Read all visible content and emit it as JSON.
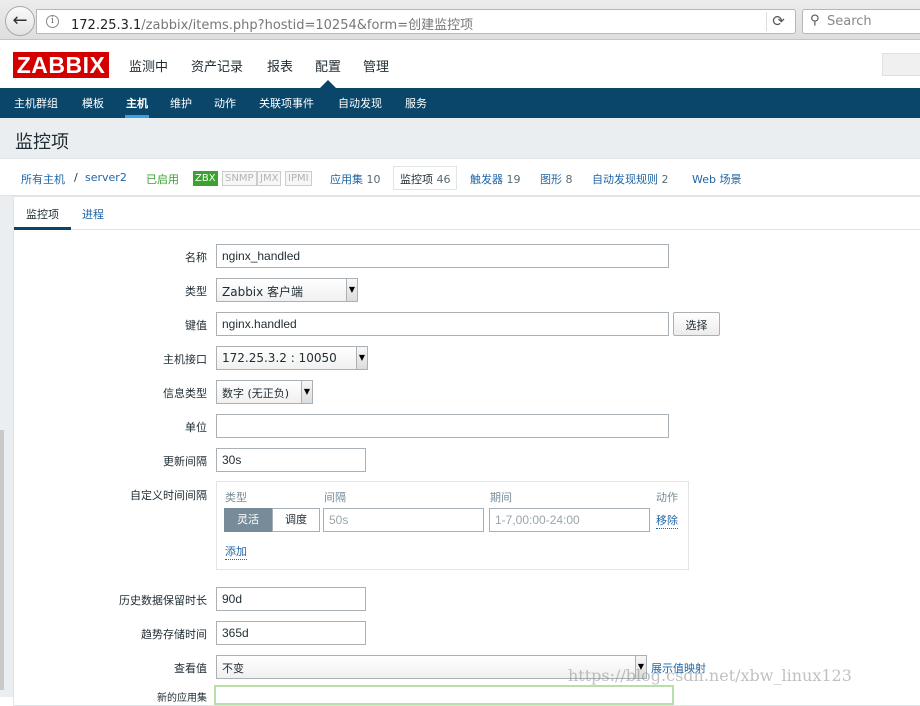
{
  "browser": {
    "url_host": "172.25.3.1",
    "url_rest": "/zabbix/items.php?hostid=10254&form=创建监控项",
    "search_placeholder": "Search"
  },
  "header": {
    "logo": "ZABBIX",
    "menu": [
      "监测中",
      "资产记录",
      "报表",
      "配置",
      "管理"
    ],
    "active_menu": "配置"
  },
  "submenu": {
    "items": [
      "主机群组",
      "模板",
      "主机",
      "维护",
      "动作",
      "关联项事件",
      "自动发现",
      "服务"
    ],
    "active": "主机"
  },
  "page_title": "监控项",
  "breadcrumb": {
    "all_hosts": "所有主机",
    "separator": "/",
    "host": "server2",
    "status": "已启用",
    "avail": [
      "ZBX",
      "SNMP",
      "JMX",
      "IPMI"
    ],
    "applications": {
      "label": "应用集",
      "count": "10"
    },
    "items": {
      "label": "监控项",
      "count": "46"
    },
    "triggers": {
      "label": "触发器",
      "count": "19"
    },
    "graphs": {
      "label": "图形",
      "count": "8"
    },
    "discovery": {
      "label": "自动发现规则",
      "count": "2"
    },
    "web": "Web 场景"
  },
  "tabs": [
    "监控项",
    "进程"
  ],
  "form": {
    "name": {
      "label": "名称",
      "value": "nginx_handled"
    },
    "type": {
      "label": "类型",
      "value": "Zabbix 客户端"
    },
    "key": {
      "label": "键值",
      "value": "nginx.handled",
      "button": "选择"
    },
    "interface": {
      "label": "主机接口",
      "value": "172.25.3.2 : 10050"
    },
    "info_type": {
      "label": "信息类型",
      "value": "数字 (无正负)"
    },
    "units": {
      "label": "单位",
      "value": ""
    },
    "update_interval": {
      "label": "更新间隔",
      "value": "30s"
    },
    "custom_intervals": {
      "label": "自定义时间间隔",
      "headers": [
        "类型",
        "间隔",
        "期间",
        "动作"
      ],
      "type_options": [
        "灵活",
        "调度"
      ],
      "interval_placeholder": "50s",
      "period_placeholder": "1-7,00:00-24:00",
      "remove": "移除",
      "add": "添加"
    },
    "history": {
      "label": "历史数据保留时长",
      "value": "90d"
    },
    "trends": {
      "label": "趋势存储时间",
      "value": "365d"
    },
    "value_map": {
      "label": "查看值",
      "value": "不变",
      "link": "展示值映射"
    },
    "new_app": {
      "label": "新的应用集"
    }
  },
  "watermark": "https://blog.csdn.net/xbw_linux123"
}
